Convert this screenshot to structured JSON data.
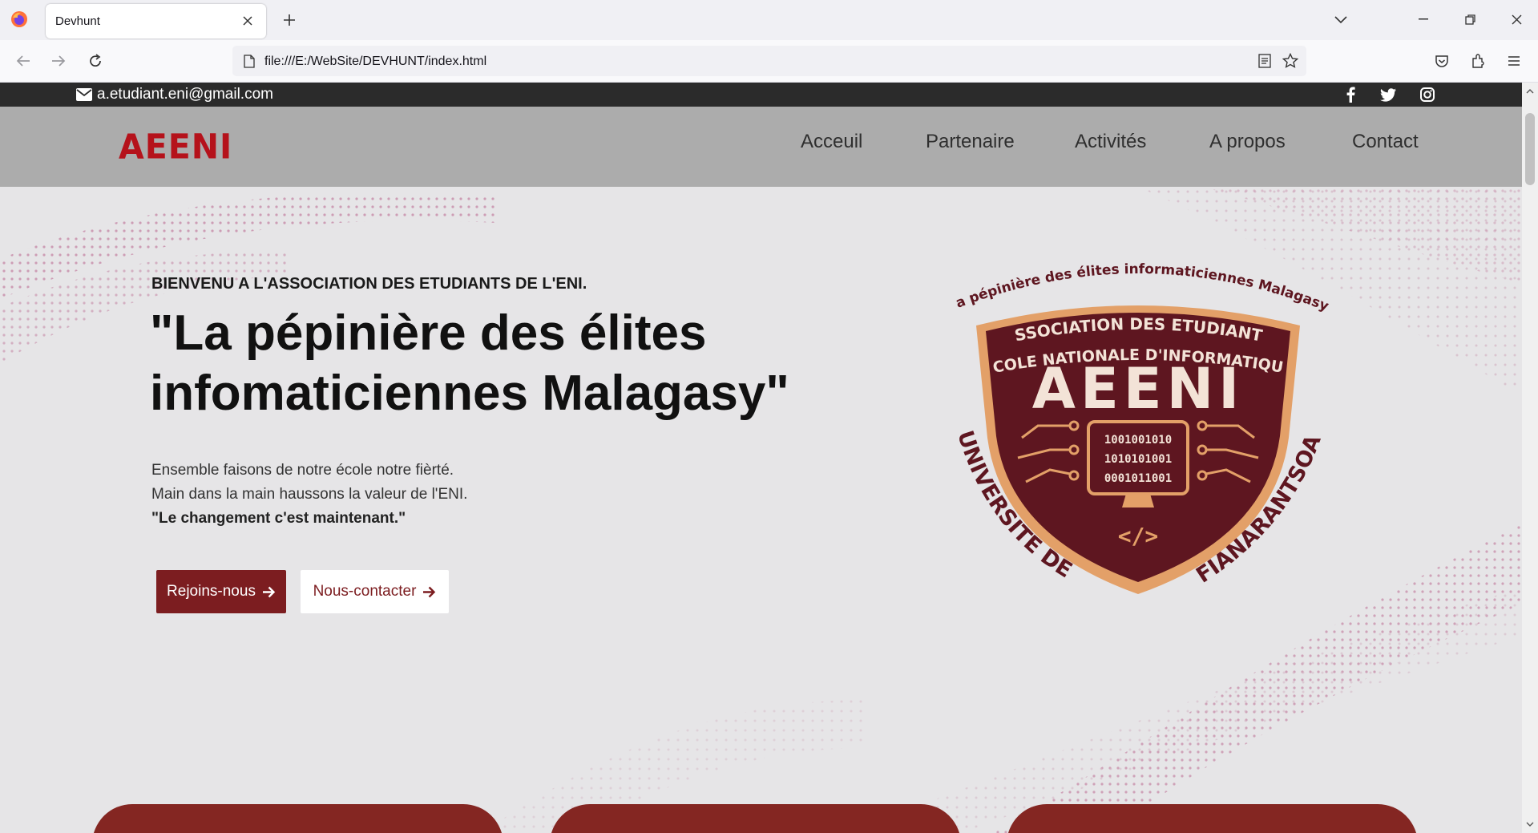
{
  "browser": {
    "tab_title": "Devhunt",
    "url": "file:///E:/WebSite/DEVHUNT/index.html",
    "icons": [
      "firefox-logo",
      "close-icon",
      "plus-icon",
      "chevron-down-icon",
      "minimize-icon",
      "restore-icon",
      "close-window-icon",
      "back-arrow-icon",
      "forward-arrow-icon",
      "reload-icon",
      "page-icon",
      "reader-view-icon",
      "bookmark-star-icon",
      "pocket-icon",
      "extensions-icon",
      "hamburger-menu-icon"
    ]
  },
  "topbar": {
    "email": "a.etudiant.eni@gmail.com",
    "social": [
      "facebook-icon",
      "twitter-icon",
      "instagram-icon"
    ]
  },
  "header": {
    "brand": "AEENI",
    "menu": [
      "Acceuil",
      "Partenaire",
      "Activités",
      "A propos",
      "Contact"
    ]
  },
  "hero": {
    "kicker": "BIENVENU A L'ASSOCIATION DES ETUDIANTS DE L'ENI.",
    "title_line1": "\"La pépinière des élites",
    "title_line2": "infomaticiennes Malagasy\"",
    "para1": "Ensemble faisons de notre école notre fièrté.",
    "para2": "Main dans la main haussons la valeur de l'ENI.",
    "para3": "\"Le changement c'est maintenant.\"",
    "btn_primary": "Rejoins-nous",
    "btn_secondary": "Nous-contacter"
  },
  "emblem": {
    "arc_text": "“La pépinière des élites informaticiennes Malagasy”",
    "line1": "ASSOCIATION DES ETUDIANTS",
    "line2": "ECOLE NATIONALE D'INFORMATIQUE",
    "name": "AEENI",
    "binary1": "1001001010",
    "binary2": "1010101001",
    "binary3": "0001011001",
    "code": "</>",
    "left_text": "UNIVERSITE DE",
    "right_text": "FIANARANTSOA"
  },
  "colors": {
    "brand_red": "#b5121b",
    "maroon": "#7c1d20",
    "emblem_fill": "#5e1620",
    "emblem_border": "#e3a068"
  }
}
